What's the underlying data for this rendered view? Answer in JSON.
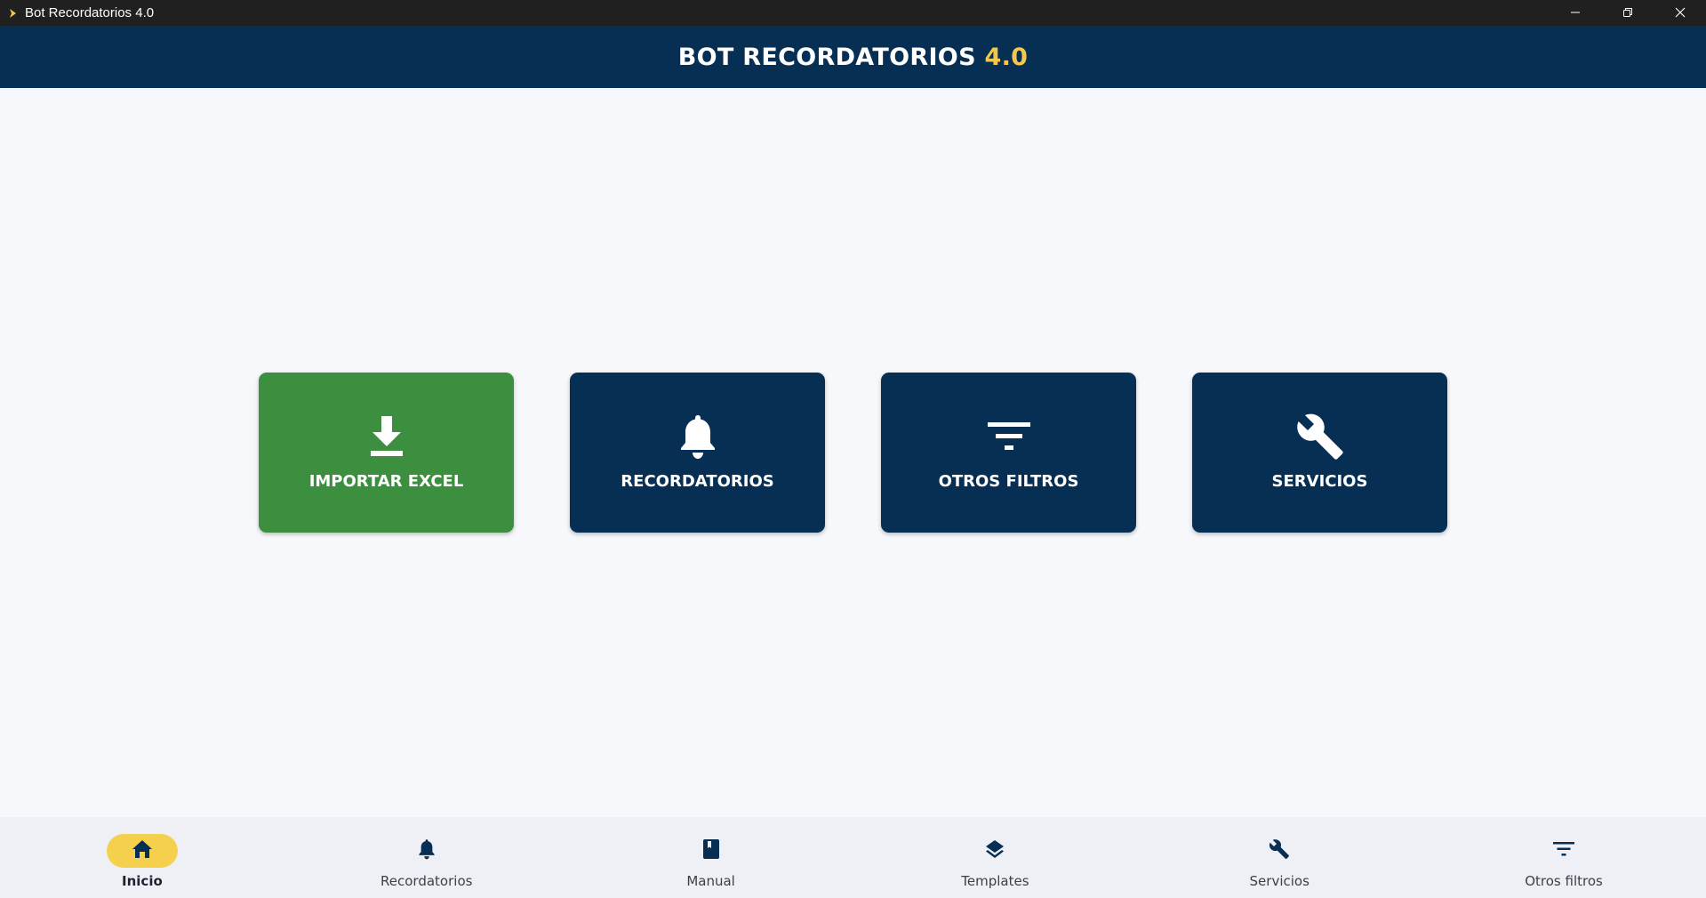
{
  "window": {
    "title": "Bot Recordatorios 4.0",
    "icon": "play-arrow-icon",
    "controls": [
      "minimize-icon",
      "restore-icon",
      "close-icon"
    ]
  },
  "header": {
    "title_main": "BOT RECORDATORIOS",
    "title_version": "4.0",
    "accent_color": "#f5c84c",
    "background_color": "#062f53"
  },
  "cards": [
    {
      "label": "IMPORTAR EXCEL",
      "icon": "download-icon",
      "color": "#3b8f3f"
    },
    {
      "label": "RECORDATORIOS",
      "icon": "bell-icon",
      "color": "#062f53"
    },
    {
      "label": "OTROS FILTROS",
      "icon": "filter-icon",
      "color": "#062f53"
    },
    {
      "label": "SERVICIOS",
      "icon": "wrench-icon",
      "color": "#062f53"
    }
  ],
  "bottom_nav": {
    "active_index": 0,
    "active_color": "#f5d04d",
    "items": [
      {
        "label": "Inicio",
        "icon": "home-icon"
      },
      {
        "label": "Recordatorios",
        "icon": "bell-icon"
      },
      {
        "label": "Manual",
        "icon": "book-icon"
      },
      {
        "label": "Templates",
        "icon": "layers-icon"
      },
      {
        "label": "Servicios",
        "icon": "wrench-icon"
      },
      {
        "label": "Otros filtros",
        "icon": "filter-icon"
      }
    ]
  }
}
